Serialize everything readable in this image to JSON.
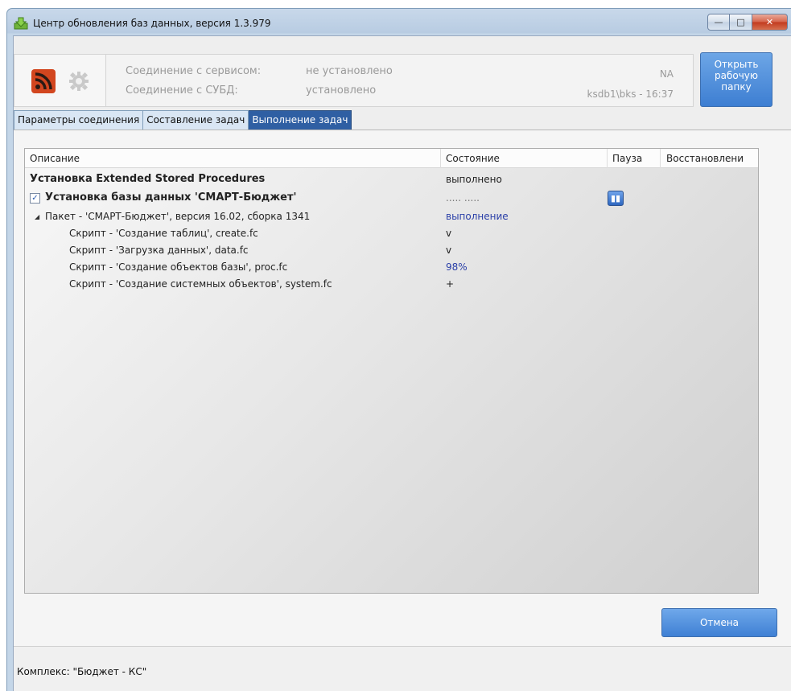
{
  "window": {
    "title": "Центр обновления баз данных, версия 1.3.979",
    "controls": {
      "minimize": "—",
      "maximize": "□",
      "close": "✕"
    }
  },
  "status": {
    "service_label": "Соединение с сервисом:",
    "service_value": "не установлено",
    "dbms_label": "Соединение с СУБД:",
    "dbms_value": "установлено",
    "na": "NA",
    "session": "ksdb1\\bks - 16:37",
    "icons": [
      "rss-icon",
      "gear-icon"
    ]
  },
  "open_folder_button": {
    "line1": "Открыть",
    "line2": "рабочую",
    "line3": "папку"
  },
  "tabs": [
    {
      "label": "Параметры соединения",
      "active": false
    },
    {
      "label": "Составление задач",
      "active": false
    },
    {
      "label": "Выполнение задач",
      "active": true
    }
  ],
  "grid": {
    "columns": [
      "Описание",
      "Состояние",
      "Пауза",
      "Восстановлени"
    ],
    "rows": [
      {
        "description": "Установка Extended Stored Procedures",
        "state": "выполнено"
      },
      {
        "description": "Установка базы данных 'СМАРТ-Бюджет'",
        "state": "..... .....",
        "checked": true,
        "checkmark": "✓",
        "pause_icon": "▮▮"
      },
      {
        "description": "Пакет - 'СМАРТ-Бюджет', версия 16.02, сборка 1341",
        "state": "выполнение",
        "tree_arrow": "◢"
      },
      {
        "description": "Скрипт - 'Создание таблиц', create.fc",
        "state": "v"
      },
      {
        "description": "Скрипт - 'Загрузка данных', data.fc",
        "state": "v"
      },
      {
        "description": "Скрипт - 'Создание объектов базы', proc.fc",
        "state": "98%"
      },
      {
        "description": "Скрипт - 'Создание системных объектов', system.fc",
        "state": "+"
      }
    ]
  },
  "cancel_button": "Отмена",
  "footer": {
    "complex": "Комплекс: \"Бюджет - КС\""
  },
  "colors": {
    "accent": "#2f5fa3",
    "state_blue": "#2a3fa8",
    "button_blue": "#3f80d4"
  }
}
